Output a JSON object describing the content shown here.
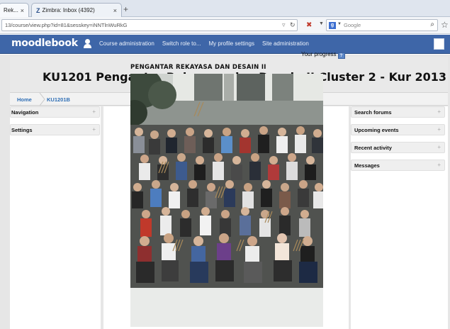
{
  "browser": {
    "tabs": [
      {
        "label": "Rek...",
        "close": "×",
        "active": true
      },
      {
        "label": "Zimbra: Inbox (4392)",
        "icon": "Z",
        "close": "×",
        "active": false
      }
    ],
    "new_tab": "+",
    "url": "13/course/view.php?id=81&sesskey=iNNTlnWuRkG",
    "search_placeholder": "Google",
    "search_engine": "g"
  },
  "moodle": {
    "logo": "moodlebook",
    "nav_links": [
      "Course administration",
      "Switch role to...",
      "My profile settings",
      "Site administration"
    ],
    "course_title": "KU1201 Pengantar Rekayasa dan Desain II Cluster 2 - Kur 2013",
    "breadcrumb": [
      "Home",
      "KU1201B"
    ],
    "left_blocks": [
      {
        "label": "Navigation",
        "toggle": "+"
      },
      {
        "label": "Settings",
        "toggle": "+"
      }
    ],
    "right_blocks": [
      {
        "label": "Search forums",
        "toggle": "+"
      },
      {
        "label": "Upcoming events",
        "toggle": "+"
      },
      {
        "label": "Recent activity",
        "toggle": "+"
      },
      {
        "label": "Messages",
        "toggle": "+"
      }
    ],
    "progress_label": "Your progress",
    "progress_icon": "?",
    "section_title": "PENGANTAR REKAYASA DAN DESAIN II"
  },
  "colors": {
    "navbar": "#3e66a8",
    "link": "#2e6eb5",
    "page_bg": "#e6e6e6"
  }
}
